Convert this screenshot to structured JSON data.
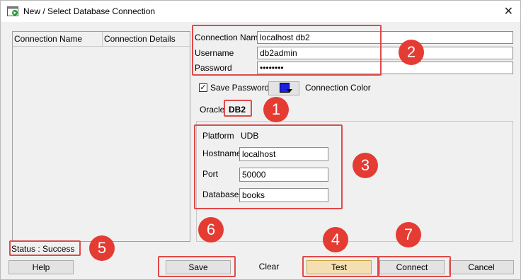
{
  "window": {
    "title": "New / Select Database Connection",
    "close_label": "✕"
  },
  "list": {
    "columns": [
      "Connection Name",
      "Connection Details"
    ]
  },
  "form": {
    "connection_name_label": "Connection Name",
    "connection_name_value": "localhost db2",
    "username_label": "Username",
    "username_value": "db2admin",
    "password_label": "Password",
    "password_value": "••••••••",
    "save_password_label": "Save Password",
    "save_password_checked": true,
    "connection_color_label": "Connection Color",
    "connection_color": "#1a20e0"
  },
  "tabs": [
    {
      "label": "Oracle",
      "active": false
    },
    {
      "label": "DB2",
      "active": true
    }
  ],
  "db2": {
    "platform_label": "Platform",
    "platform_value": "UDB",
    "hostname_label": "Hostname",
    "hostname_value": "localhost",
    "port_label": "Port",
    "port_value": "50000",
    "database_label": "Database",
    "database_value": "books"
  },
  "status": {
    "text": "Status : Success"
  },
  "buttons": {
    "help": "Help",
    "save": "Save",
    "clear": "Clear",
    "test": "Test",
    "connect": "Connect",
    "cancel": "Cancel"
  },
  "annotations": [
    "1",
    "2",
    "3",
    "4",
    "5",
    "6",
    "7"
  ],
  "colors": {
    "annotation": "#e43b33"
  }
}
